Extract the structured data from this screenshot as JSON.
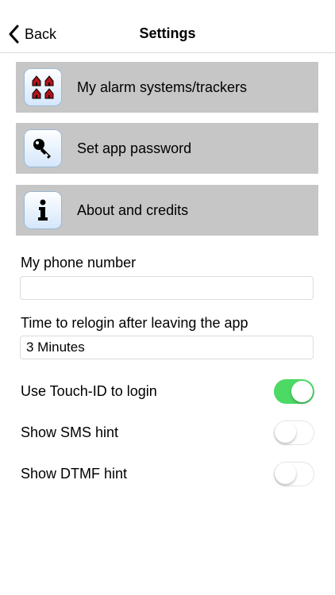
{
  "navbar": {
    "back_label": "Back",
    "title": "Settings"
  },
  "menu": [
    {
      "label": "My alarm systems/trackers",
      "icon": "houses-icon"
    },
    {
      "label": "Set app password",
      "icon": "key-icon"
    },
    {
      "label": "About and credits",
      "icon": "info-icon"
    }
  ],
  "phone": {
    "label": "My phone number",
    "value": ""
  },
  "relogin": {
    "label": "Time to relogin after leaving the app",
    "value": "3 Minutes"
  },
  "toggles": [
    {
      "label": "Use Touch-ID to login",
      "on": true
    },
    {
      "label": "Show SMS hint",
      "on": false
    },
    {
      "label": "Show DTMF hint",
      "on": false
    }
  ],
  "colors": {
    "switch_on": "#4cd964",
    "menu_bg": "#c6c6c6"
  }
}
